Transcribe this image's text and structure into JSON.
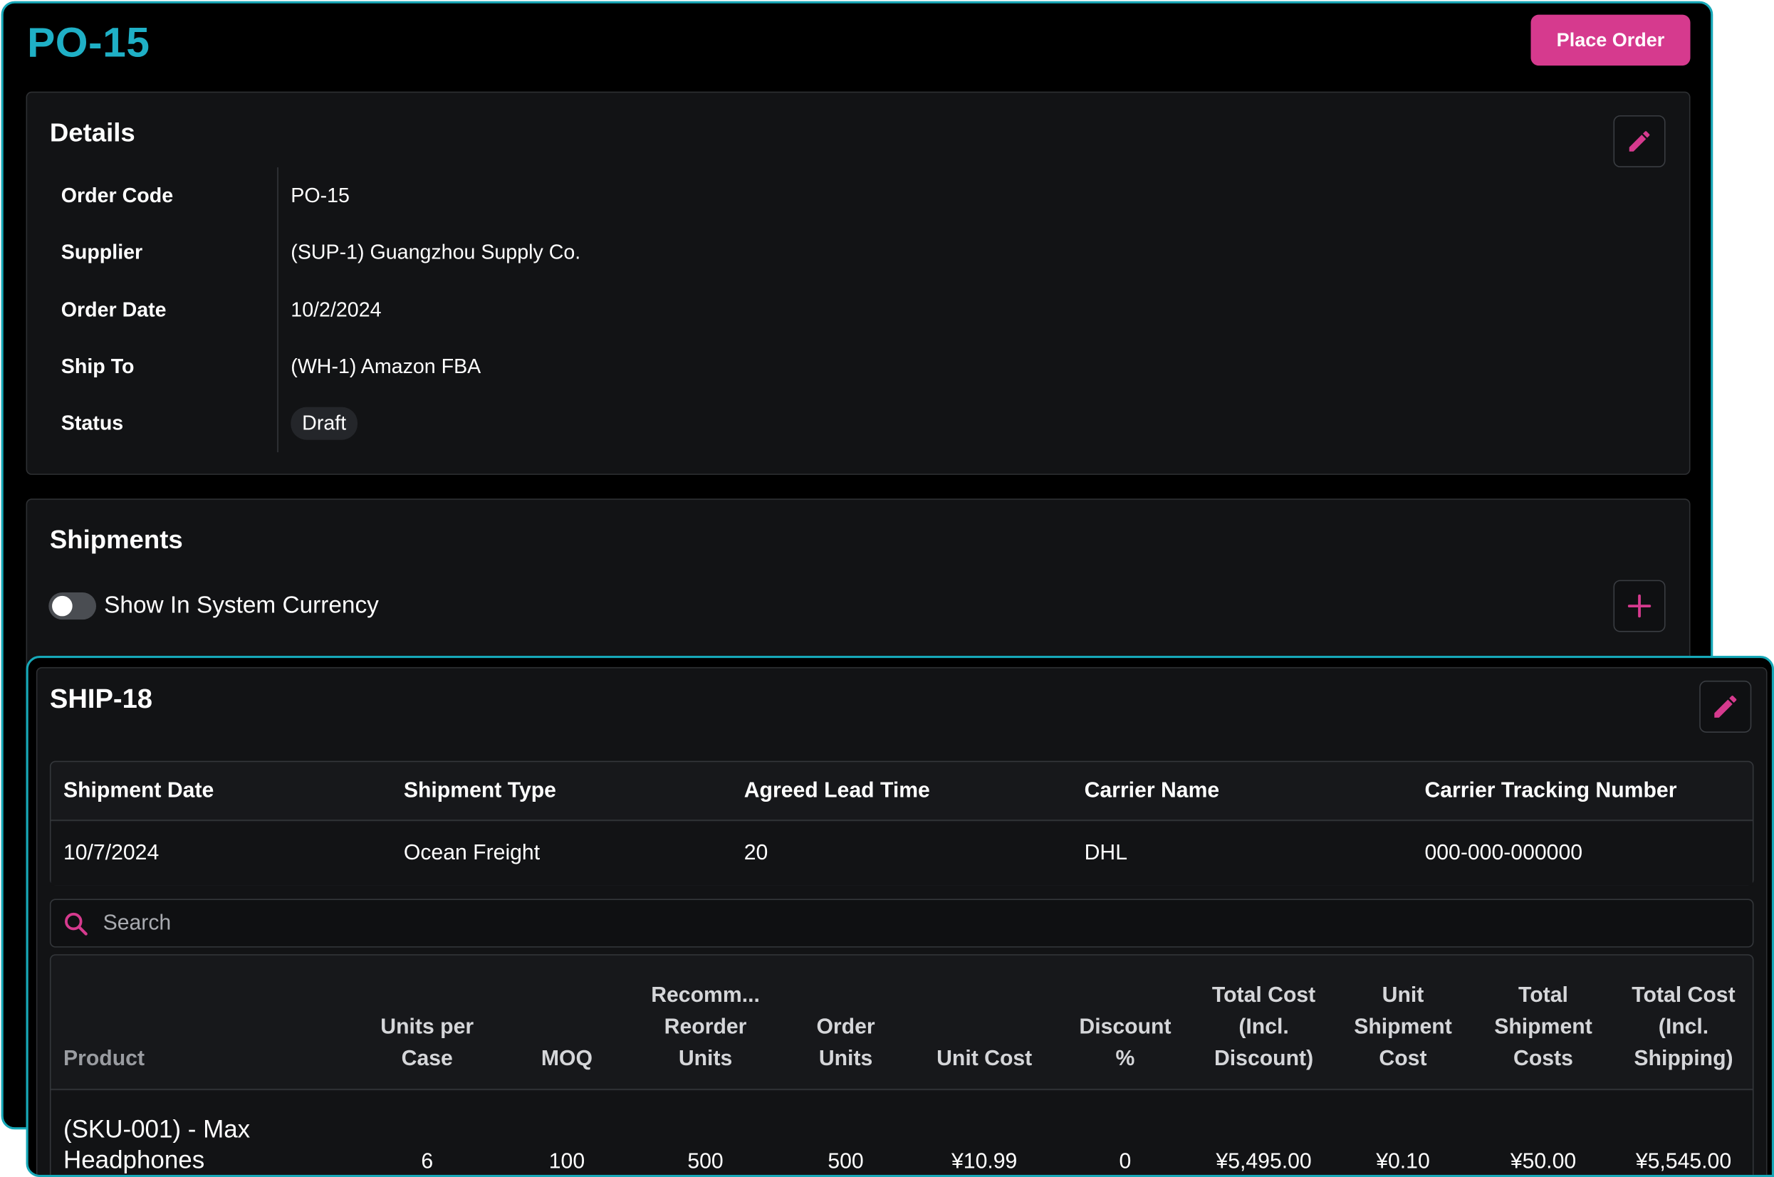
{
  "order": {
    "title": "PO-15",
    "place_order_label": "Place Order"
  },
  "details": {
    "title": "Details",
    "edit_icon": "pencil-icon",
    "fields": [
      {
        "label": "Order Code",
        "value": "PO-15"
      },
      {
        "label": "Supplier",
        "value": "(SUP-1) Guangzhou Supply Co."
      },
      {
        "label": "Order Date",
        "value": "10/2/2024"
      },
      {
        "label": "Ship To",
        "value": "(WH-1) Amazon FBA"
      },
      {
        "label": "Status",
        "value": "Draft"
      }
    ]
  },
  "shipments": {
    "title": "Shipments",
    "toggle_label": "Show In System Currency",
    "toggle_on": false,
    "add_icon": "plus-icon"
  },
  "shipment": {
    "title": "SHIP-18",
    "edit_icon": "pencil-icon",
    "info_headers": [
      "Shipment Date",
      "Shipment Type",
      "Agreed Lead Time",
      "Carrier Name",
      "Carrier Tracking Number"
    ],
    "info_values": [
      "10/7/2024",
      "Ocean Freight",
      "20",
      "DHL",
      "000-000-000000"
    ],
    "search_placeholder": "Search",
    "columns": [
      "Product",
      "Units per\nCase",
      "MOQ",
      "Recomm...\nReorder\nUnits",
      "Order\nUnits",
      "Unit Cost",
      "Discount\n%",
      "Total Cost\n(Incl.\nDiscount)",
      "Unit\nShipment\nCost",
      "Total\nShipment\nCosts",
      "Total Cost\n(Incl.\nShipping)"
    ],
    "rows": [
      [
        "(SKU-001) - Max Headphones",
        "6",
        "100",
        "500",
        "500",
        "¥10.99",
        "0",
        "¥5,495.00",
        "¥0.10",
        "¥50.00",
        "¥5,545.00"
      ]
    ]
  },
  "colors": {
    "accent": "#d63a8e",
    "title": "#1fb0c6",
    "window_border": "#17a8b8"
  }
}
